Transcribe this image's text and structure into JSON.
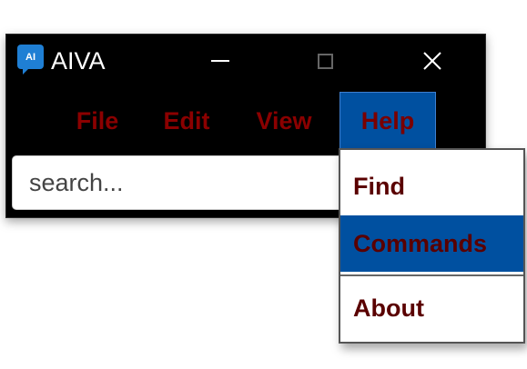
{
  "window": {
    "app_icon_text": "AI",
    "title": "AIVA"
  },
  "menubar": {
    "items": [
      {
        "label": "File"
      },
      {
        "label": "Edit"
      },
      {
        "label": "View"
      },
      {
        "label": "Help",
        "active": true
      }
    ]
  },
  "search": {
    "placeholder": "search..."
  },
  "help_menu": {
    "items": [
      {
        "label": "Find"
      },
      {
        "label": "Commands",
        "highlighted": true
      },
      {
        "label": "About"
      }
    ]
  },
  "colors": {
    "window_bg": "#000000",
    "menu_text": "#8b0000",
    "highlight_bg": "#0050a0",
    "app_icon_bg": "#1f7fd4"
  },
  "icons": {
    "app": "ai-chat-icon",
    "minimize": "minimize-icon",
    "maximize": "maximize-icon",
    "close": "close-icon"
  }
}
